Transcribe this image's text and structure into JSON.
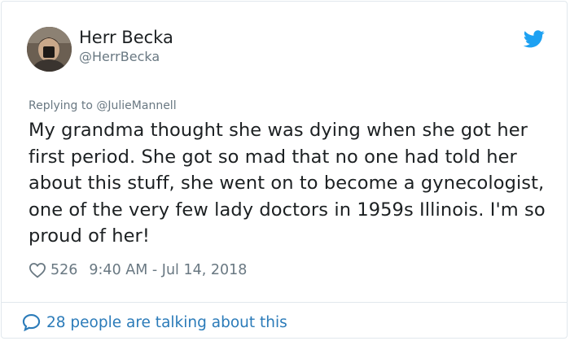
{
  "author": {
    "display_name": "Herr Becka",
    "handle": "@HerrBecka"
  },
  "icons": {
    "avatar": "profile-photo",
    "brand": "twitter-bird-icon",
    "like": "heart-icon",
    "conversation": "speech-bubble-icon"
  },
  "reply": {
    "prefix": "Replying to",
    "mention": "@JulieMannell"
  },
  "tweet": {
    "text": "My grandma thought she was dying when she got her first period. She got so mad that no one had told her about this stuff, she went on to become a gynecologist, one of the very few lady doctors in 1959s Illinois. I'm so proud of her!",
    "likes": "526",
    "timestamp": "9:40 AM - Jul 14, 2018"
  },
  "footer": {
    "talking": "28 people are talking about this"
  },
  "colors": {
    "brand_blue": "#1da1f2",
    "link_blue": "#2b7bb9",
    "muted_gray": "#697882",
    "border": "#e1e8ed"
  }
}
